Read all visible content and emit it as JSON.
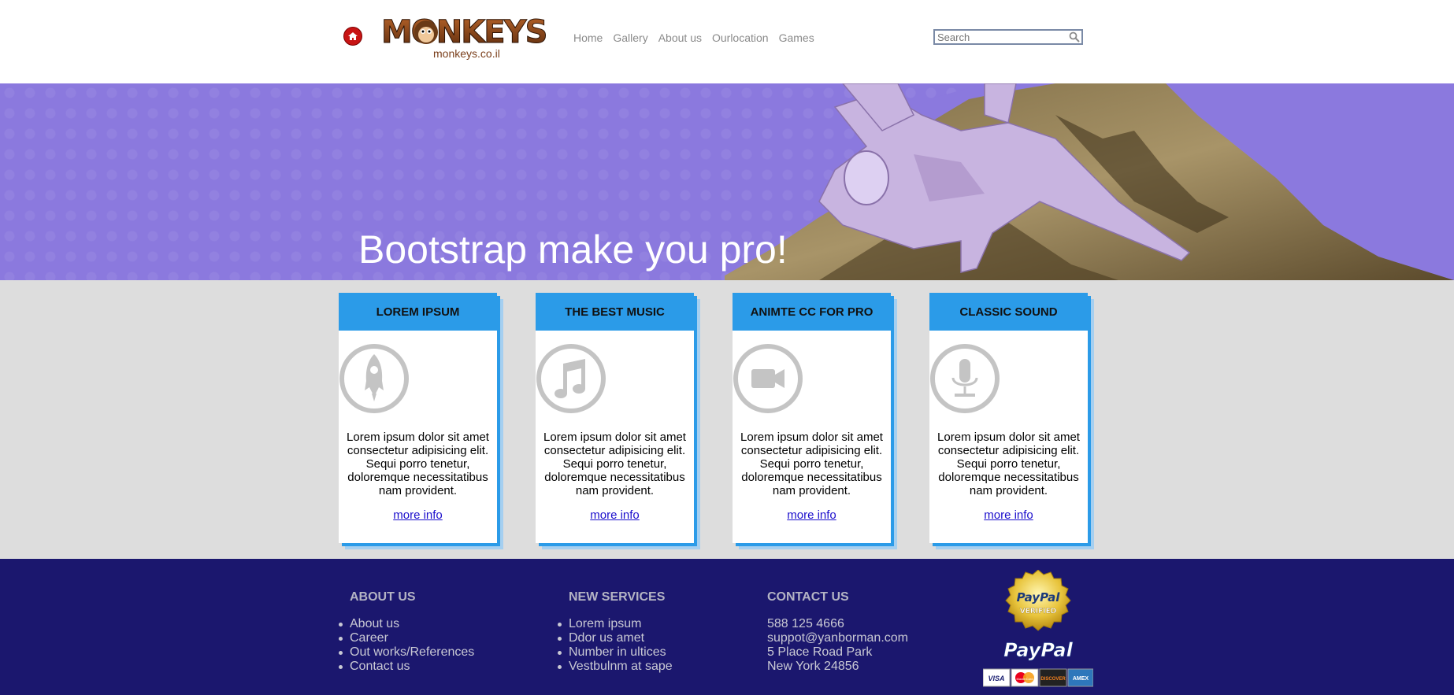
{
  "header": {
    "logo_title": "MONKEYS",
    "logo_sub": "monkeys.co.il",
    "nav": [
      "Home",
      "Gallery",
      "About us",
      "Ourlocation",
      "Games"
    ],
    "search_placeholder": "Search"
  },
  "hero": {
    "title": "Bootstrap make you pro!"
  },
  "cards": [
    {
      "title": "LOREM IPSUM",
      "icon": "rocket-icon",
      "text": "Lorem ipsum dolor sit amet consectetur adipisicing elit. Sequi porro tenetur, doloremque necessitatibus nam provident.",
      "link": "more info"
    },
    {
      "title": "THE BEST MUSIC",
      "icon": "music-note-icon",
      "text": "Lorem ipsum dolor sit amet consectetur adipisicing elit. Sequi porro tenetur, doloremque necessitatibus nam provident.",
      "link": "more info"
    },
    {
      "title": "ANIMTE CC FOR PRO",
      "icon": "video-camera-icon",
      "text": "Lorem ipsum dolor sit amet consectetur adipisicing elit. Sequi porro tenetur, doloremque necessitatibus nam provident.",
      "link": "more info"
    },
    {
      "title": "CLASSIC SOUND",
      "icon": "microphone-icon",
      "text": "Lorem ipsum dolor sit amet consectetur adipisicing elit. Sequi porro tenetur, doloremque necessitatibus nam provident.",
      "link": "more info"
    }
  ],
  "footer": {
    "about": {
      "title": "ABOUT US",
      "items": [
        "About us",
        "Career",
        "Out works/References",
        "Contact us"
      ]
    },
    "services": {
      "title": "NEW SERVICES",
      "items": [
        "Lorem ipsum",
        "Ddor us amet",
        "Number in ultices",
        "Vestbulnm at sape"
      ]
    },
    "contact": {
      "title": "CONTACT US",
      "items": [
        "588 125 4666",
        "suppot@yanborman.com",
        "5 Place Road Park",
        "New York 24856"
      ]
    },
    "paypal": {
      "seal_line1": "PayPal",
      "seal_line2": "VERIFIED",
      "wordmark": "PayPal",
      "cards": [
        "VISA",
        "MasterCard",
        "DISCOVER",
        "AMEX"
      ]
    }
  },
  "colors": {
    "hero_bg": "#8b79de",
    "card_accent": "#2b9be8",
    "footer_bg": "#1b176e",
    "cards_area_bg": "#dddddd"
  }
}
